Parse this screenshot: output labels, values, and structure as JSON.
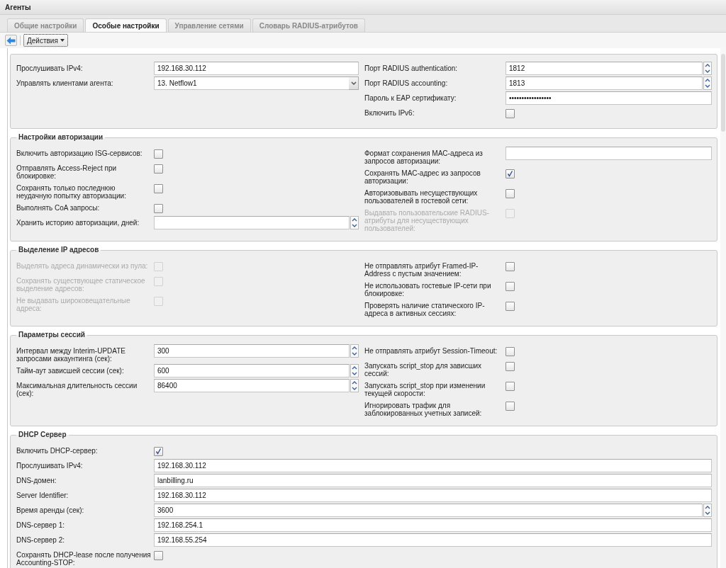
{
  "window": {
    "title": "Агенты"
  },
  "tabs": [
    {
      "label": "Общие настройки",
      "selected": false
    },
    {
      "label": "Особые настройки",
      "selected": true
    },
    {
      "label": "Управление сетями",
      "selected": false
    },
    {
      "label": "Словарь RADIUS-атрибутов",
      "selected": false
    }
  ],
  "toolbar": {
    "actions_button": "Действия"
  },
  "panels": [
    {
      "columns": [
        [
          {
            "kind": "text",
            "label": "Прослушивать IPv4:",
            "value": "192.168.30.112"
          },
          {
            "kind": "select",
            "label": "Управлять клиентами агента:",
            "value": "13. Netflow1"
          }
        ],
        [
          {
            "kind": "spinner",
            "label": "Порт RADIUS authentication:",
            "value": "1812"
          },
          {
            "kind": "spinner",
            "label": "Порт RADIUS accounting:",
            "value": "1813"
          },
          {
            "kind": "password",
            "label": "Пароль к EAP сертификату:",
            "value": "•••••••••••••••••"
          },
          {
            "kind": "checkbox",
            "label": "Включить IPv6:",
            "checked": false,
            "disabled": false
          }
        ]
      ]
    },
    {
      "title": "Настройки авторизации",
      "columns": [
        [
          {
            "kind": "checkbox",
            "label": "Включить авторизацию ISG-сервисов:",
            "checked": false,
            "disabled": false
          },
          {
            "kind": "checkbox",
            "label": "Отправлять Access-Reject при блокировке:",
            "checked": false,
            "disabled": false
          },
          {
            "kind": "checkbox",
            "label": "Сохранять только последнюю неудачную попытку авторизации:",
            "checked": false,
            "disabled": false
          },
          {
            "kind": "checkbox",
            "label": "Выполнять CoA запросы:",
            "checked": false,
            "disabled": false
          },
          {
            "kind": "spinner",
            "label": "Хранить историю авторизации, дней:"
          }
        ],
        [
          {
            "kind": "text",
            "label": "Формат сохранения MAC-адреса из запросов авторизации:"
          },
          {
            "kind": "checkbox",
            "label": "Сохранять MAC-адрес из запросов авторизации:",
            "checked": true,
            "disabled": false
          },
          {
            "kind": "checkbox",
            "label": "Авторизовывать несуществующих пользователей в гостевой сети:",
            "checked": false,
            "disabled": false
          },
          {
            "kind": "checkbox",
            "label": "Выдавать пользовательские RADIUS-атрибуты для несуществующих пользователей:",
            "checked": false,
            "disabled": true
          }
        ]
      ]
    },
    {
      "title": "Выделение IP адресов",
      "columns": [
        [
          {
            "kind": "checkbox",
            "label": "Выделять адреса динамически из пула:",
            "checked": false,
            "disabled": true
          },
          {
            "kind": "checkbox",
            "label": "Сохранять существующее статическое выделение адресов:",
            "checked": false,
            "disabled": true
          },
          {
            "kind": "checkbox",
            "label": "Не выдавать широковещательные адреса:",
            "checked": false,
            "disabled": true
          }
        ],
        [
          {
            "kind": "checkbox",
            "label": "Не отправлять атрибут Framed-IP-Address с пустым значением:",
            "checked": false,
            "disabled": false
          },
          {
            "kind": "checkbox",
            "label": "Не использовать гостевые IP-сети при блокировке:",
            "checked": false,
            "disabled": false
          },
          {
            "kind": "checkbox",
            "label": "Проверять наличие статического IP-адреса в активных сессиях:",
            "checked": false,
            "disabled": false
          }
        ]
      ]
    },
    {
      "title": "Параметры сессий",
      "columns": [
        [
          {
            "kind": "spinner",
            "label": "Интервал между Interim-UPDATE запросами аккаунтинга (сек):",
            "value": "300"
          },
          {
            "kind": "spinner",
            "label": "Тайм-аут зависшей сессии (сек):",
            "value": "600"
          },
          {
            "kind": "spinner",
            "label": "Максимальная длительность сессии (сек):",
            "value": "86400"
          }
        ],
        [
          {
            "kind": "checkbox",
            "label": "Не отправлять атрибут Session-Timeout:",
            "checked": false,
            "disabled": false
          },
          {
            "kind": "checkbox",
            "label": "Запускать script_stop для зависших сессий:",
            "checked": false,
            "disabled": false
          },
          {
            "kind": "checkbox",
            "label": "Запускать script_stop при изменении текущей скорости:",
            "checked": false,
            "disabled": false
          },
          {
            "kind": "checkbox",
            "label": "Игнорировать трафик для заблокированных учетных записей:",
            "checked": false,
            "disabled": false
          }
        ]
      ]
    },
    {
      "title": "DHCP Сервер",
      "columns": [
        [
          {
            "kind": "checkbox",
            "label": "Включить DHCP-сервер:",
            "checked": true,
            "disabled": false
          },
          {
            "kind": "text",
            "label": "Прослушивать IPv4:",
            "value": "192.168.30.112"
          },
          {
            "kind": "text",
            "label": "DNS-домен:",
            "value": "lanbilling.ru"
          },
          {
            "kind": "text",
            "label": "Server Identifier:",
            "value": "192.168.30.112"
          },
          {
            "kind": "spinner",
            "label": "Время аренды (сек):",
            "value": "3600"
          },
          {
            "kind": "text",
            "label": "DNS-сервер 1:",
            "value": "192.168.254.1"
          },
          {
            "kind": "text",
            "label": "DNS-сервер 2:",
            "value": "192.168.55.254"
          },
          {
            "kind": "checkbox",
            "label": "Сохранять DHCP-lease после получения Accounting-STOP:",
            "checked": false,
            "disabled": false
          }
        ]
      ]
    }
  ]
}
